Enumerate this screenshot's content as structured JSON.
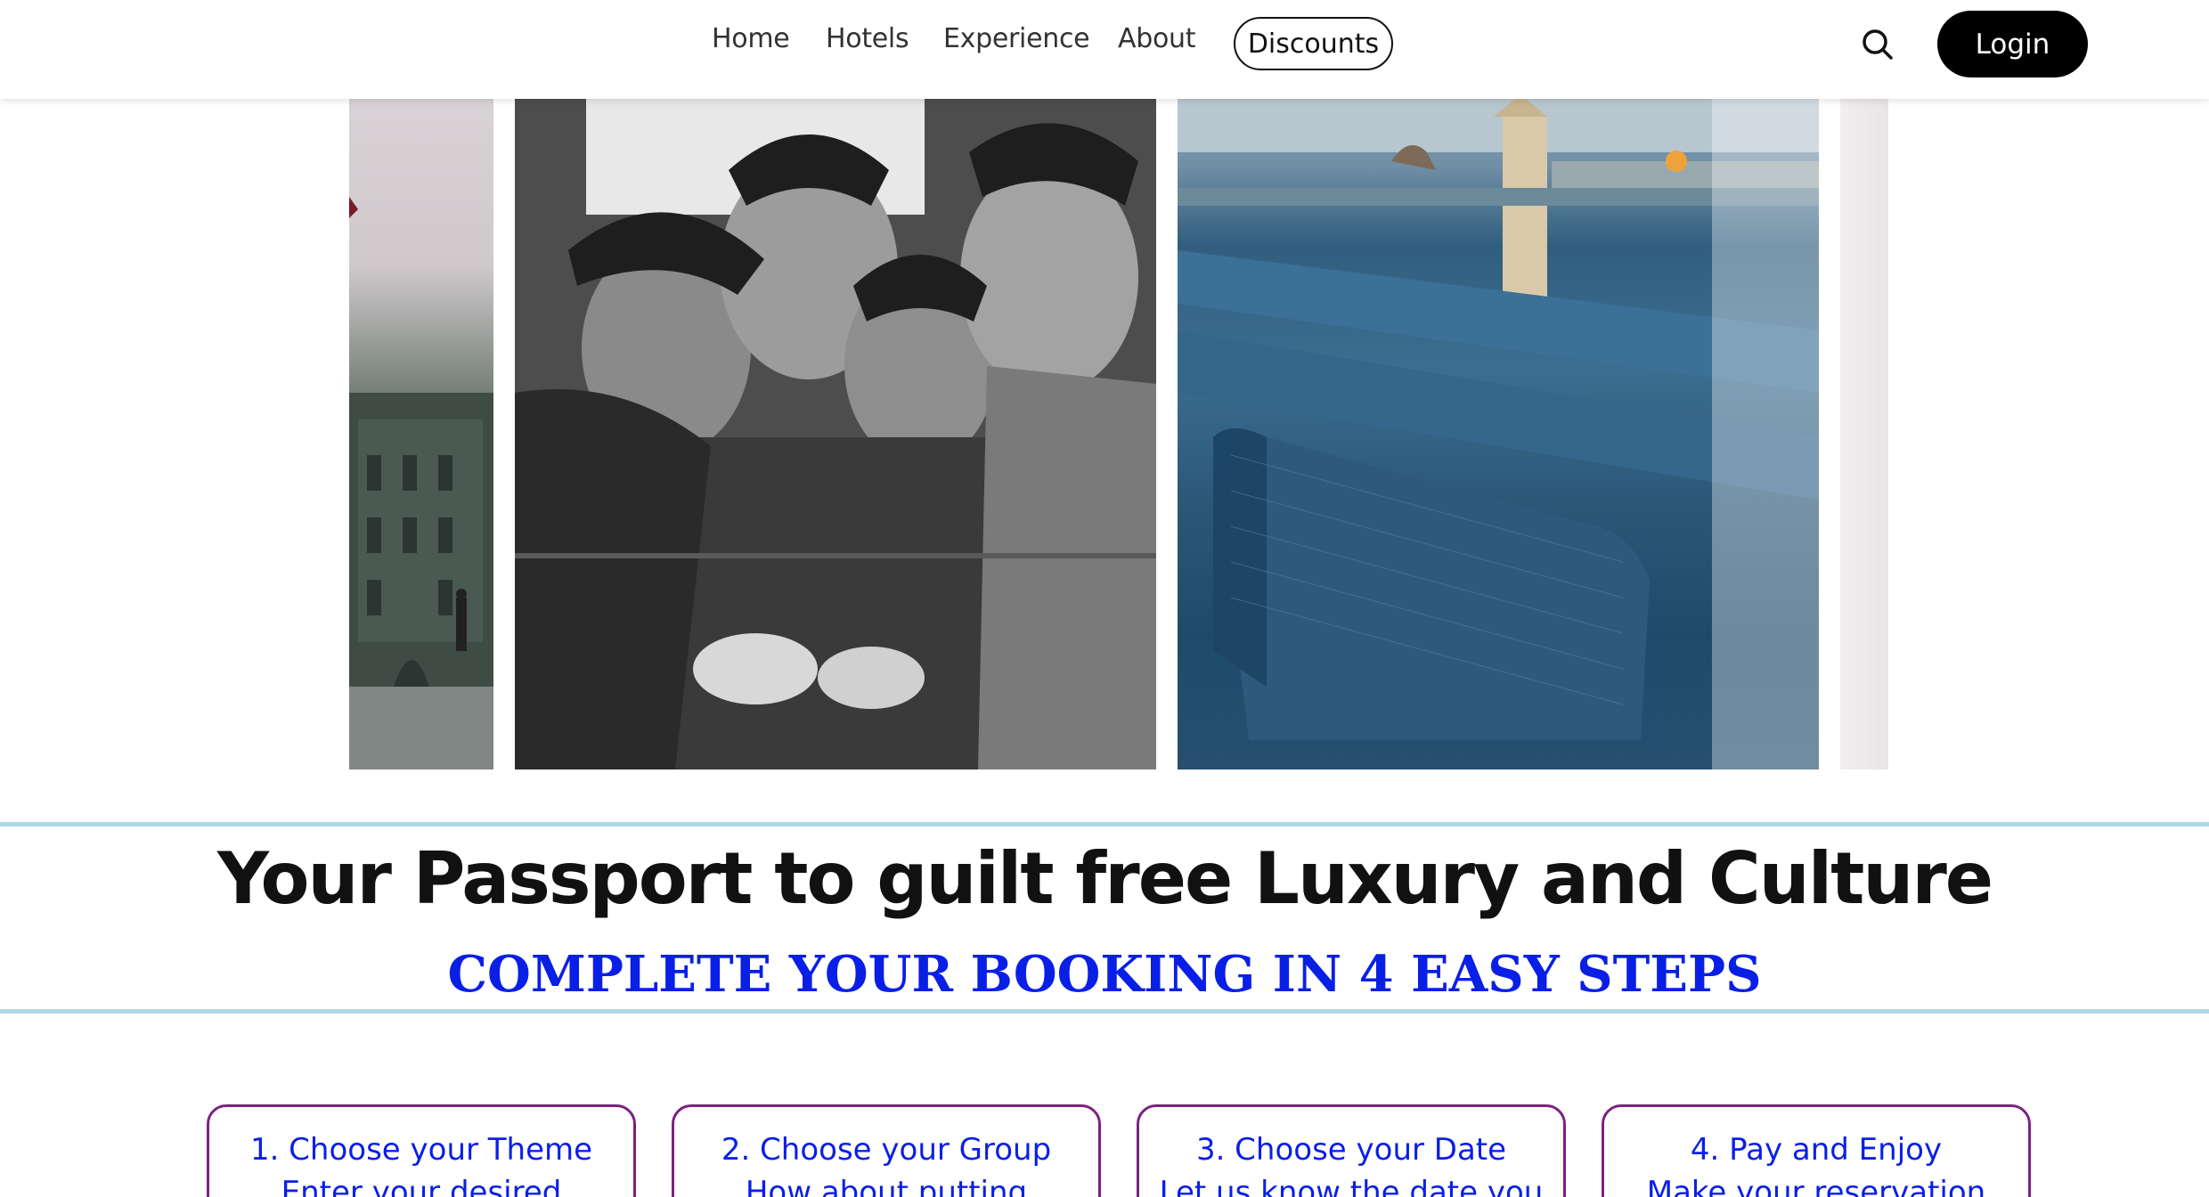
{
  "nav": {
    "items": [
      "Home",
      "Hotels",
      "Experience",
      "About"
    ],
    "discounts_label": "Discounts",
    "search_icon": "search-icon",
    "login_label": "Login"
  },
  "gallery": {
    "images": [
      "city-plaza-photo",
      "children-smiling-photo",
      "hotel-pool-photo",
      "next-photo"
    ]
  },
  "hero": {
    "title": "Your Passport to guilt free Luxury and Culture",
    "subtitle": "COMPLETE YOUR BOOKING IN 4 EASY STEPS"
  },
  "steps": [
    {
      "title": "1. Choose your Theme",
      "desc": "Enter your desired"
    },
    {
      "title": "2. Choose your Group",
      "desc": "How about putting"
    },
    {
      "title": "3. Choose your Date",
      "desc": "Let us know the date you"
    },
    {
      "title": "4. Pay and Enjoy",
      "desc": "Make your reservation"
    }
  ],
  "colors": {
    "accent_blue": "#0a1fe6",
    "card_border": "#7d2181",
    "divider": "#add8e6",
    "login_bg": "#000000"
  }
}
